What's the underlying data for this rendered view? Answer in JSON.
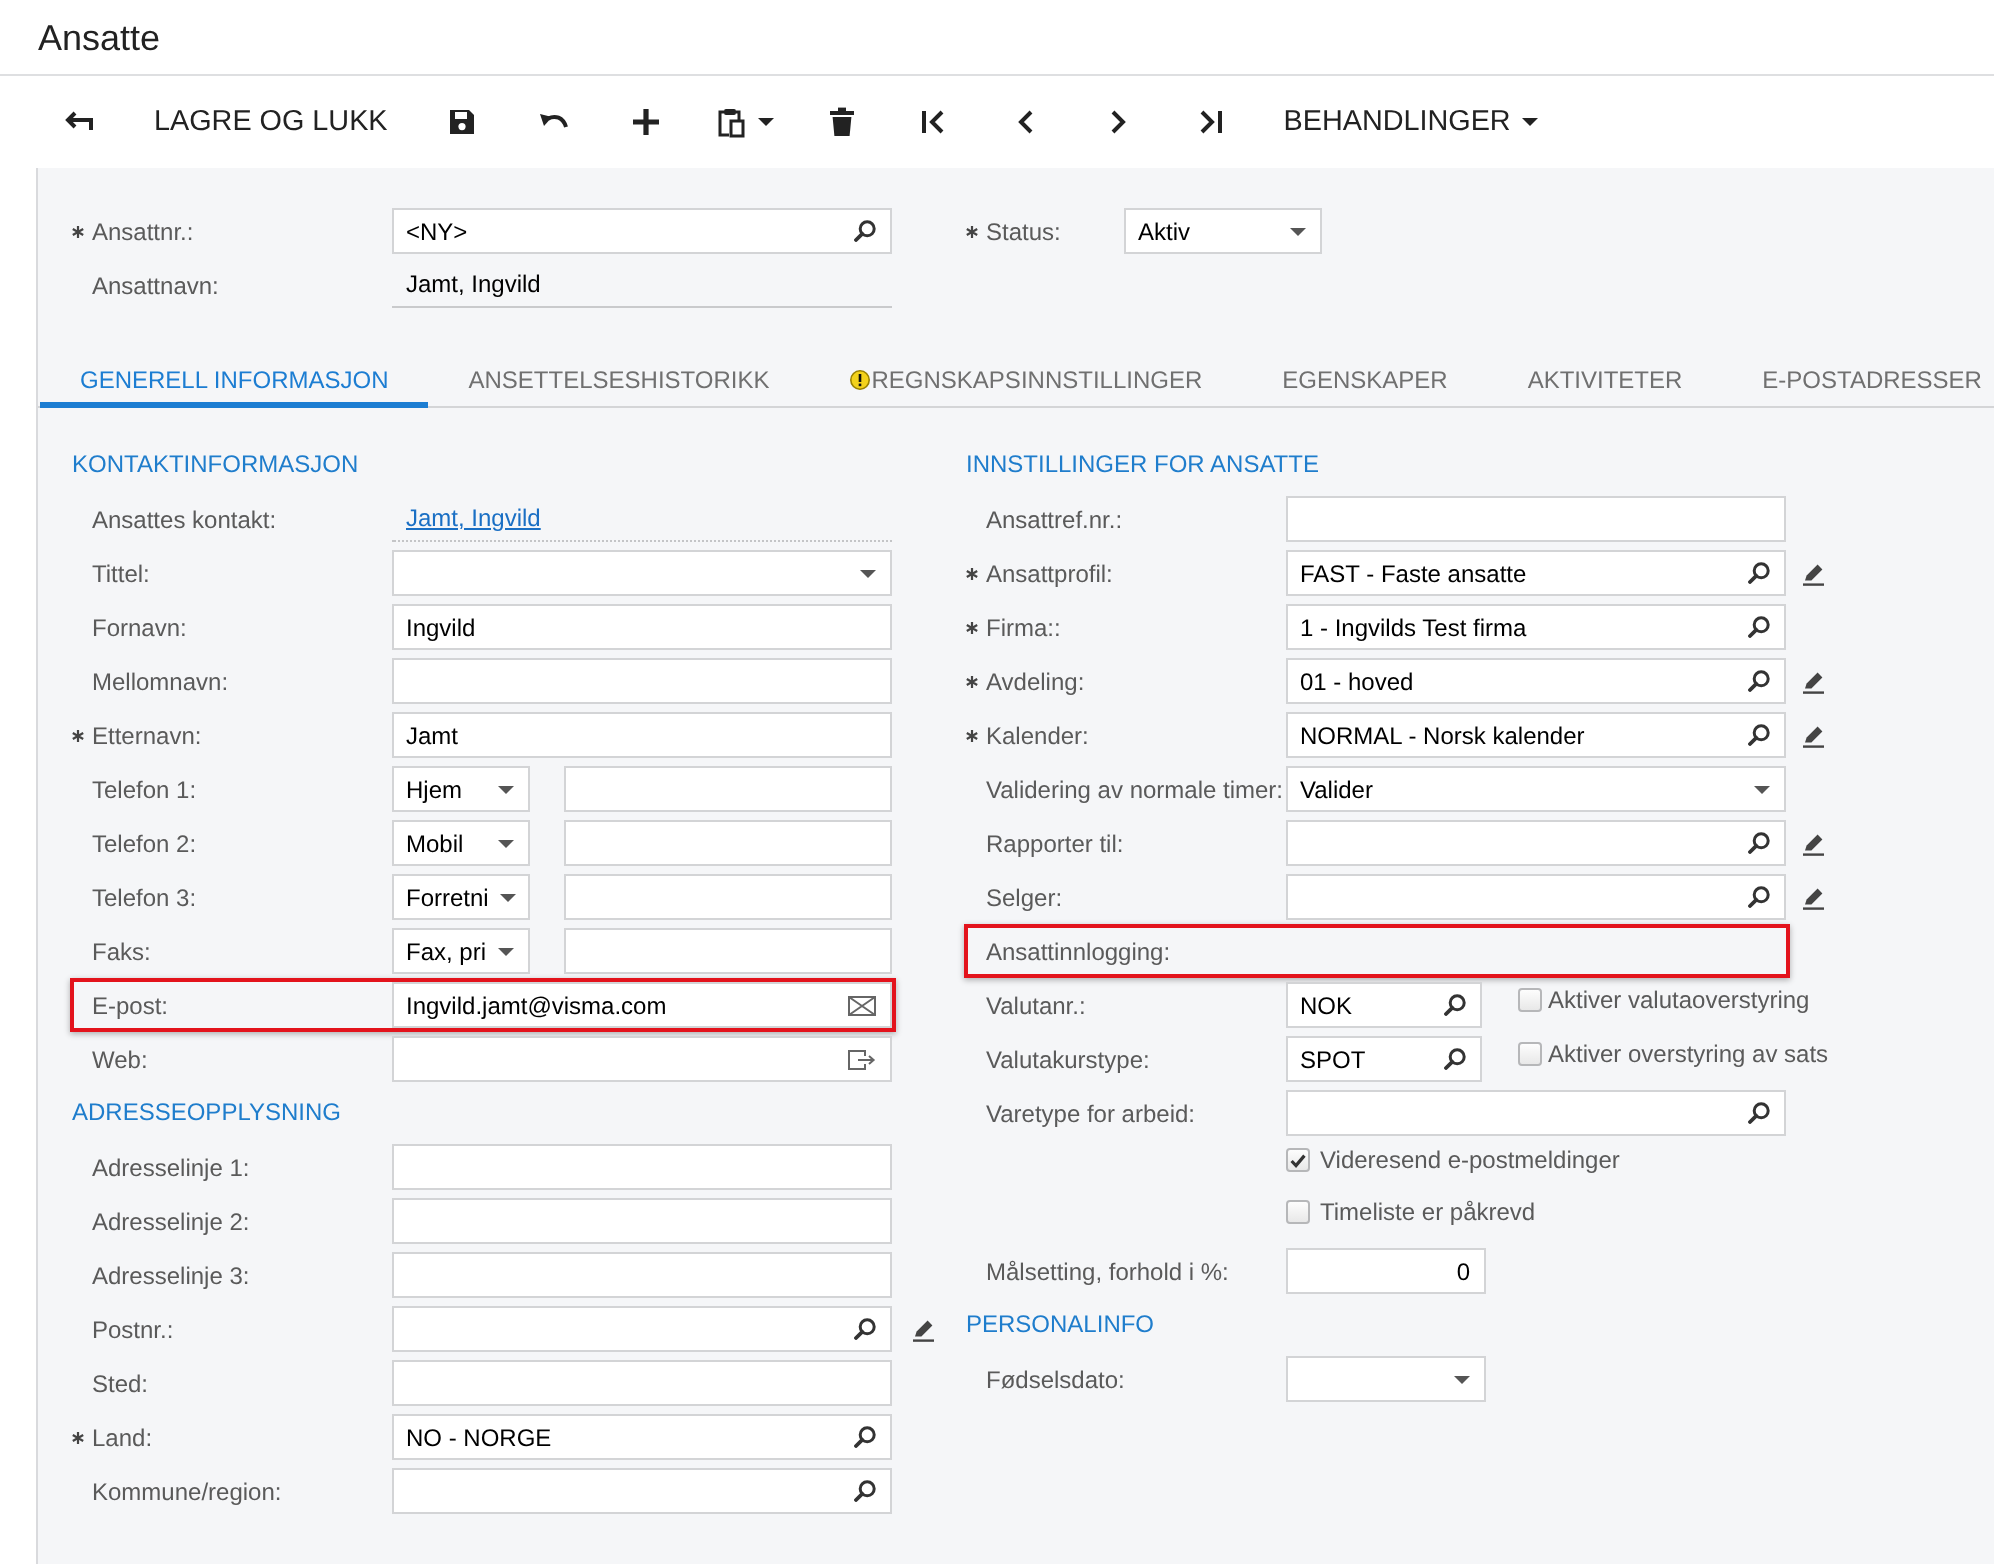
{
  "page": {
    "title": "Ansatte"
  },
  "toolbar": [
    {
      "kind": "back",
      "menu": false
    },
    {
      "kind": "save_close",
      "label": "LAGRE OG LUKK",
      "menu": false
    },
    {
      "kind": "save",
      "menu": false
    },
    {
      "kind": "undo",
      "menu": false
    },
    {
      "kind": "add",
      "menu": false
    },
    {
      "kind": "paste",
      "menu": true
    },
    {
      "kind": "delete",
      "menu": false
    },
    {
      "kind": "first",
      "menu": false
    },
    {
      "kind": "previous",
      "menu": false
    },
    {
      "kind": "next",
      "menu": false
    },
    {
      "kind": "last",
      "menu": false
    },
    {
      "kind": "actions",
      "label": "BEHANDLINGER",
      "menu": true
    }
  ],
  "header": [
    {
      "fields": [
        {
          "kind": "lookup",
          "label": "Ansattnr.:",
          "required": true,
          "value": "<NY>",
          "edit": false,
          "highlighted": false
        },
        {
          "kind": "display",
          "label": "Ansattnavn:",
          "required": false,
          "value": "Jamt, Ingvild",
          "edit": false,
          "highlighted": false
        }
      ]
    },
    {
      "fields": [
        {
          "kind": "select",
          "label": "Status:",
          "required": true,
          "value": "Aktiv",
          "edit": false,
          "highlighted": false
        }
      ]
    }
  ],
  "tabs": [
    {
      "label": "GENERELL INFORMASJON",
      "selected": true,
      "warning": false
    },
    {
      "label": "ANSETTELSESHISTORIKK",
      "selected": false,
      "warning": false
    },
    {
      "label": "REGNSKAPSINNSTILLINGER",
      "selected": false,
      "warning": true
    },
    {
      "label": "EGENSKAPER",
      "selected": false,
      "warning": false
    },
    {
      "label": "AKTIVITETER",
      "selected": false,
      "warning": false
    },
    {
      "label": "E-POSTADRESSER",
      "selected": false,
      "warning": false
    }
  ],
  "columns": [
    {
      "sections": [
        {
          "title": "KONTAKTINFORMASJON",
          "rows": [
            {
              "kind": "link",
              "label": "Ansattes kontakt:",
              "required": false,
              "value": "Jamt, Ingvild",
              "edit": false,
              "highlighted": false
            },
            {
              "kind": "select",
              "label": "Tittel:",
              "required": false,
              "edit": false,
              "highlighted": false
            },
            {
              "kind": "text",
              "label": "Fornavn:",
              "required": false,
              "value": "Ingvild",
              "edit": false,
              "highlighted": false
            },
            {
              "kind": "text",
              "label": "Mellomnavn:",
              "required": false,
              "edit": false,
              "highlighted": false
            },
            {
              "kind": "text",
              "label": "Etternavn:",
              "required": true,
              "value": "Jamt",
              "edit": false,
              "highlighted": false
            },
            {
              "kind": "phone",
              "label": "Telefon 1:",
              "required": false,
              "type": "Hjem",
              "edit": false,
              "highlighted": false
            },
            {
              "kind": "phone",
              "label": "Telefon 2:",
              "required": false,
              "type": "Mobil",
              "edit": false,
              "highlighted": false
            },
            {
              "kind": "phone",
              "label": "Telefon 3:",
              "required": false,
              "type": "Forretni",
              "edit": false,
              "highlighted": false
            },
            {
              "kind": "phone",
              "label": "Faks:",
              "required": false,
              "type": "Fax, pri",
              "edit": false,
              "highlighted": false
            },
            {
              "kind": "email",
              "label": "E-post:",
              "required": false,
              "value": "Ingvild.jamt@visma.com",
              "edit": false,
              "highlighted": true
            },
            {
              "kind": "url",
              "label": "Web:",
              "required": false,
              "edit": false,
              "highlighted": false
            }
          ]
        },
        {
          "title": "ADRESSEOPPLYSNING",
          "rows": [
            {
              "kind": "text",
              "label": "Adresselinje 1:",
              "required": false,
              "edit": false,
              "highlighted": false
            },
            {
              "kind": "text",
              "label": "Adresselinje 2:",
              "required": false,
              "edit": false,
              "highlighted": false
            },
            {
              "kind": "text",
              "label": "Adresselinje 3:",
              "required": false,
              "edit": false,
              "highlighted": false
            },
            {
              "kind": "lookup",
              "label": "Postnr.:",
              "required": false,
              "edit": true,
              "highlighted": false
            },
            {
              "kind": "text",
              "label": "Sted:",
              "required": false,
              "edit": false,
              "highlighted": false
            },
            {
              "kind": "lookup",
              "label": "Land:",
              "required": true,
              "value": "NO - NORGE",
              "edit": false,
              "highlighted": false
            },
            {
              "kind": "lookup",
              "label": "Kommune/region:",
              "required": false,
              "edit": false,
              "highlighted": false
            }
          ]
        }
      ]
    },
    {
      "sections": [
        {
          "title": "INNSTILLINGER FOR ANSATTE",
          "rows": [
            {
              "kind": "text",
              "label": "Ansattref.nr.:",
              "required": false,
              "edit": false,
              "highlighted": false
            },
            {
              "kind": "lookup",
              "label": "Ansattprofil:",
              "required": true,
              "value": "FAST - Faste ansatte",
              "edit": true,
              "highlighted": false
            },
            {
              "kind": "lookup",
              "label": "Firma::",
              "required": true,
              "value": "1 - Ingvilds Test firma",
              "edit": false,
              "highlighted": false
            },
            {
              "kind": "lookup",
              "label": "Avdeling:",
              "required": true,
              "value": "01 - hoved",
              "edit": true,
              "highlighted": false
            },
            {
              "kind": "lookup",
              "label": "Kalender:",
              "required": true,
              "value": "NORMAL - Norsk kalender",
              "edit": true,
              "highlighted": false
            },
            {
              "kind": "select",
              "label": "Validering av normale timer:",
              "required": false,
              "value": "Valider",
              "edit": false,
              "highlighted": false
            },
            {
              "kind": "lookup",
              "label": "Rapporter til:",
              "required": false,
              "edit": true,
              "highlighted": false
            },
            {
              "kind": "lookup",
              "label": "Selger:",
              "required": false,
              "edit": true,
              "highlighted": false
            },
            {
              "kind": "label",
              "label": "Ansattinnlogging:",
              "required": false,
              "edit": false,
              "highlighted": true
            },
            {
              "kind": "short_lookup",
              "label": "Valutanr.:",
              "required": false,
              "value": "NOK",
              "edit": false,
              "highlighted": false,
              "option": {
                "label": "Aktiver valutaoverstyring",
                "checked": false
              }
            },
            {
              "kind": "short_lookup",
              "label": "Valutakurstype:",
              "required": false,
              "value": "SPOT",
              "edit": false,
              "highlighted": false,
              "option": {
                "label": "Aktiver overstyring av sats",
                "checked": false
              }
            },
            {
              "kind": "lookup",
              "label": "Varetype for arbeid:",
              "required": false,
              "edit": false,
              "highlighted": false
            },
            {
              "kind": "checkbox",
              "label": "Videresend e-postmeldinger",
              "required": false,
              "checked": true,
              "edit": false,
              "highlighted": false
            },
            {
              "kind": "checkbox",
              "label": "Timeliste er påkrevd",
              "required": false,
              "checked": false,
              "edit": false,
              "highlighted": false
            },
            {
              "kind": "number",
              "label": "Målsetting, forhold i %:",
              "required": false,
              "value": "0",
              "edit": false,
              "highlighted": false
            }
          ]
        },
        {
          "title": "PERSONALINFO",
          "rows": [
            {
              "kind": "date",
              "label": "Fødselsdato:",
              "required": false,
              "edit": false,
              "highlighted": false
            }
          ]
        }
      ]
    }
  ]
}
